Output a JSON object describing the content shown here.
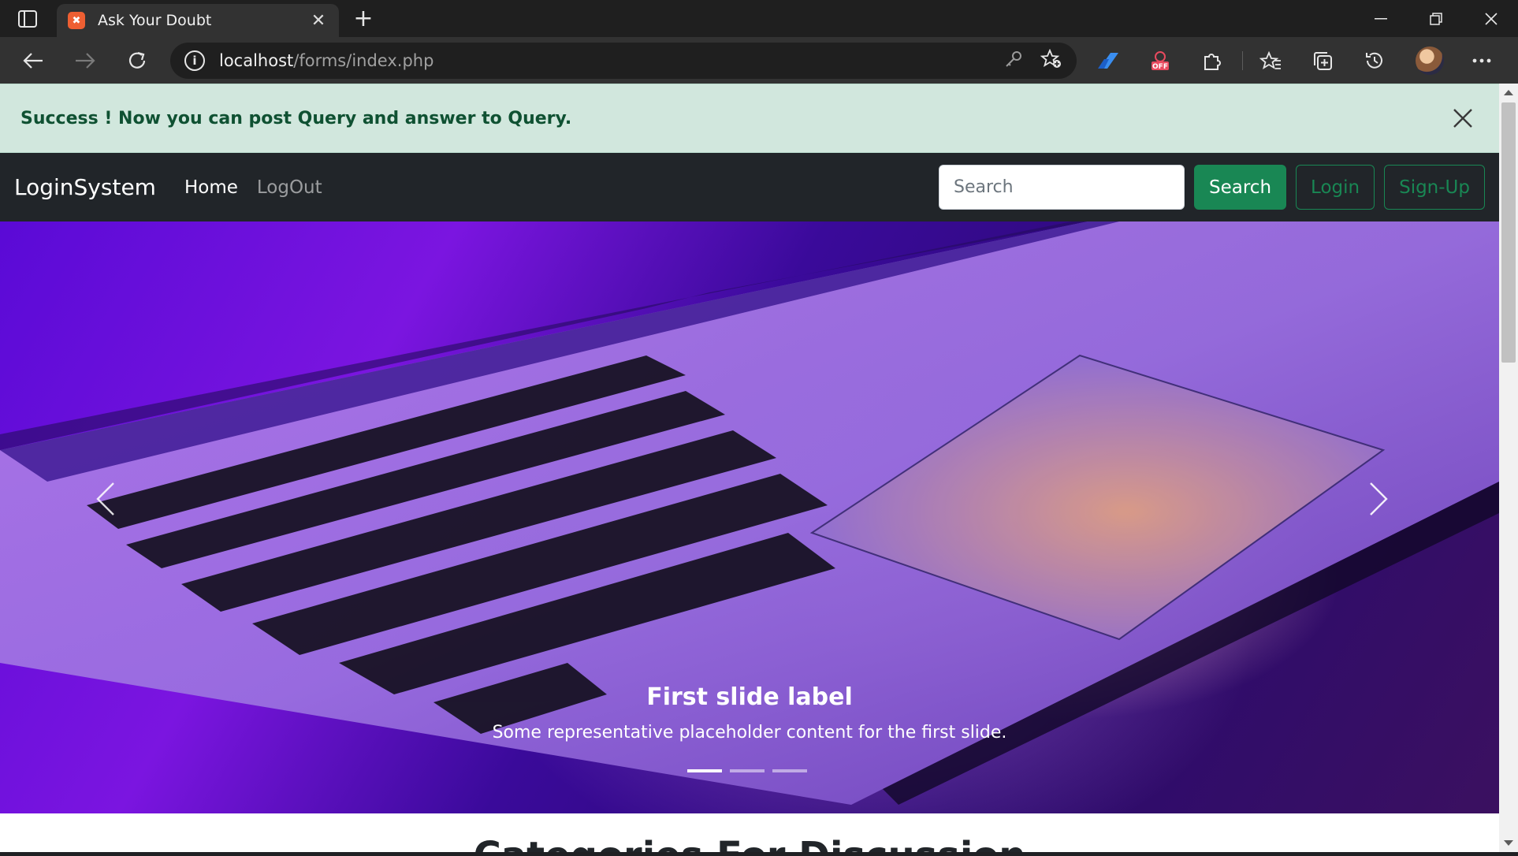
{
  "browser": {
    "tab_title": "Ask Your Doubt",
    "favicon_label": "✖",
    "url_host": "localhost",
    "url_path": "/forms/index.php"
  },
  "alert": {
    "message": "Success ! Now you can post Query and answer to Query."
  },
  "navbar": {
    "brand": "LoginSystem",
    "links": [
      {
        "label": "Home"
      },
      {
        "label": "LogOut"
      }
    ],
    "search_placeholder": "Search",
    "search_button": "Search",
    "login_button": "Login",
    "signup_button": "Sign-Up"
  },
  "carousel": {
    "caption_title": "First slide label",
    "caption_text": "Some representative placeholder content for the first slide.",
    "slide_count": 3,
    "active_slide": 1
  },
  "section": {
    "heading": "Categories For Discussion"
  },
  "colors": {
    "success": "#198754",
    "alert_bg": "#d1e7dd",
    "alert_text": "#0f5132",
    "navbar_bg": "#212529"
  }
}
